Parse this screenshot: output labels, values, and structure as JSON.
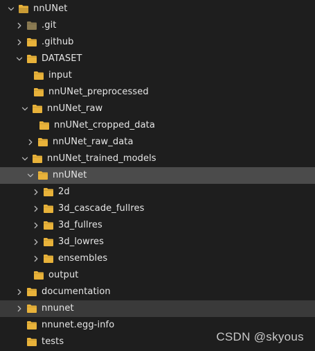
{
  "tree": [
    {
      "label": "nnUNet",
      "chevron": "down",
      "folder": "open"
    },
    {
      "label": ".git",
      "chevron": "right",
      "folder": "git"
    },
    {
      "label": ".github",
      "chevron": "right",
      "folder": "normal"
    },
    {
      "label": "DATASET",
      "chevron": "down",
      "folder": "normal"
    },
    {
      "label": "input",
      "chevron": "none",
      "folder": "normal"
    },
    {
      "label": "nnUNet_preprocessed",
      "chevron": "none",
      "folder": "normal"
    },
    {
      "label": "nnUNet_raw",
      "chevron": "down",
      "folder": "normal"
    },
    {
      "label": "nnUNet_cropped_data",
      "chevron": "none",
      "folder": "normal"
    },
    {
      "label": "nnUNet_raw_data",
      "chevron": "right",
      "folder": "normal"
    },
    {
      "label": "nnUNet_trained_models",
      "chevron": "down",
      "folder": "normal"
    },
    {
      "label": "nnUNet",
      "chevron": "down",
      "folder": "normal",
      "state": "selected"
    },
    {
      "label": "2d",
      "chevron": "right",
      "folder": "normal"
    },
    {
      "label": "3d_cascade_fullres",
      "chevron": "right",
      "folder": "normal"
    },
    {
      "label": "3d_fullres",
      "chevron": "right",
      "folder": "normal"
    },
    {
      "label": "3d_lowres",
      "chevron": "right",
      "folder": "normal"
    },
    {
      "label": "ensembles",
      "chevron": "right",
      "folder": "normal"
    },
    {
      "label": "output",
      "chevron": "none",
      "folder": "normal"
    },
    {
      "label": "documentation",
      "chevron": "right",
      "folder": "normal"
    },
    {
      "label": "nnunet",
      "chevron": "right",
      "folder": "normal",
      "state": "hover"
    },
    {
      "label": "nnunet.egg-info",
      "chevron": "none",
      "folder": "normal"
    },
    {
      "label": "tests",
      "chevron": "none",
      "folder": "normal"
    }
  ],
  "watermark": "CSDN @skyous",
  "colors": {
    "background": "#1e1e1e",
    "selected_row": "#4b4b4b",
    "hover_row": "#3a3a3a",
    "folder_yellow": "#e8b23a",
    "folder_git": "#8a7a52",
    "text": "#e6e6e6",
    "chevron": "#b8b8b8"
  },
  "icons": {
    "expand": "chevron-down-icon",
    "collapse": "chevron-right-icon",
    "folder": "folder-icon"
  }
}
